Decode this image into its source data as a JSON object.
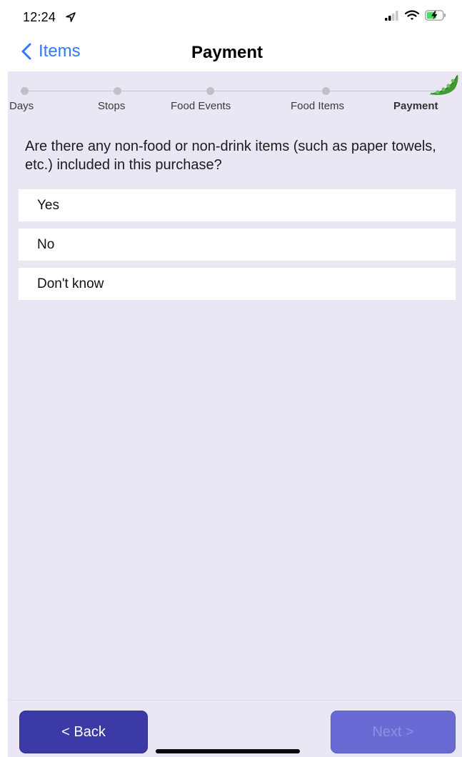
{
  "status_bar": {
    "time": "12:24",
    "icons": [
      "location-arrow-icon",
      "cellular-signal-icon",
      "wifi-icon",
      "battery-charging-icon"
    ]
  },
  "nav": {
    "back_label": "Items",
    "title": "Payment",
    "accent_color": "#3478f6"
  },
  "progress": {
    "steps": [
      "Days",
      "Stops",
      "Food Events",
      "Food Items",
      "Payment"
    ],
    "current_step": "Payment",
    "current_icon": "peapod-icon"
  },
  "question": {
    "text": "Are there any non-food or non-drink items (such as paper towels, etc.) included in this purchase?"
  },
  "options": [
    {
      "label": "Yes"
    },
    {
      "label": "No"
    },
    {
      "label": "Don't know"
    }
  ],
  "footer": {
    "back_label": "< Back",
    "next_label": "Next >",
    "next_enabled": false,
    "button_color": "#3b3aa6"
  },
  "colors": {
    "content_background": "#ebe6f4"
  }
}
